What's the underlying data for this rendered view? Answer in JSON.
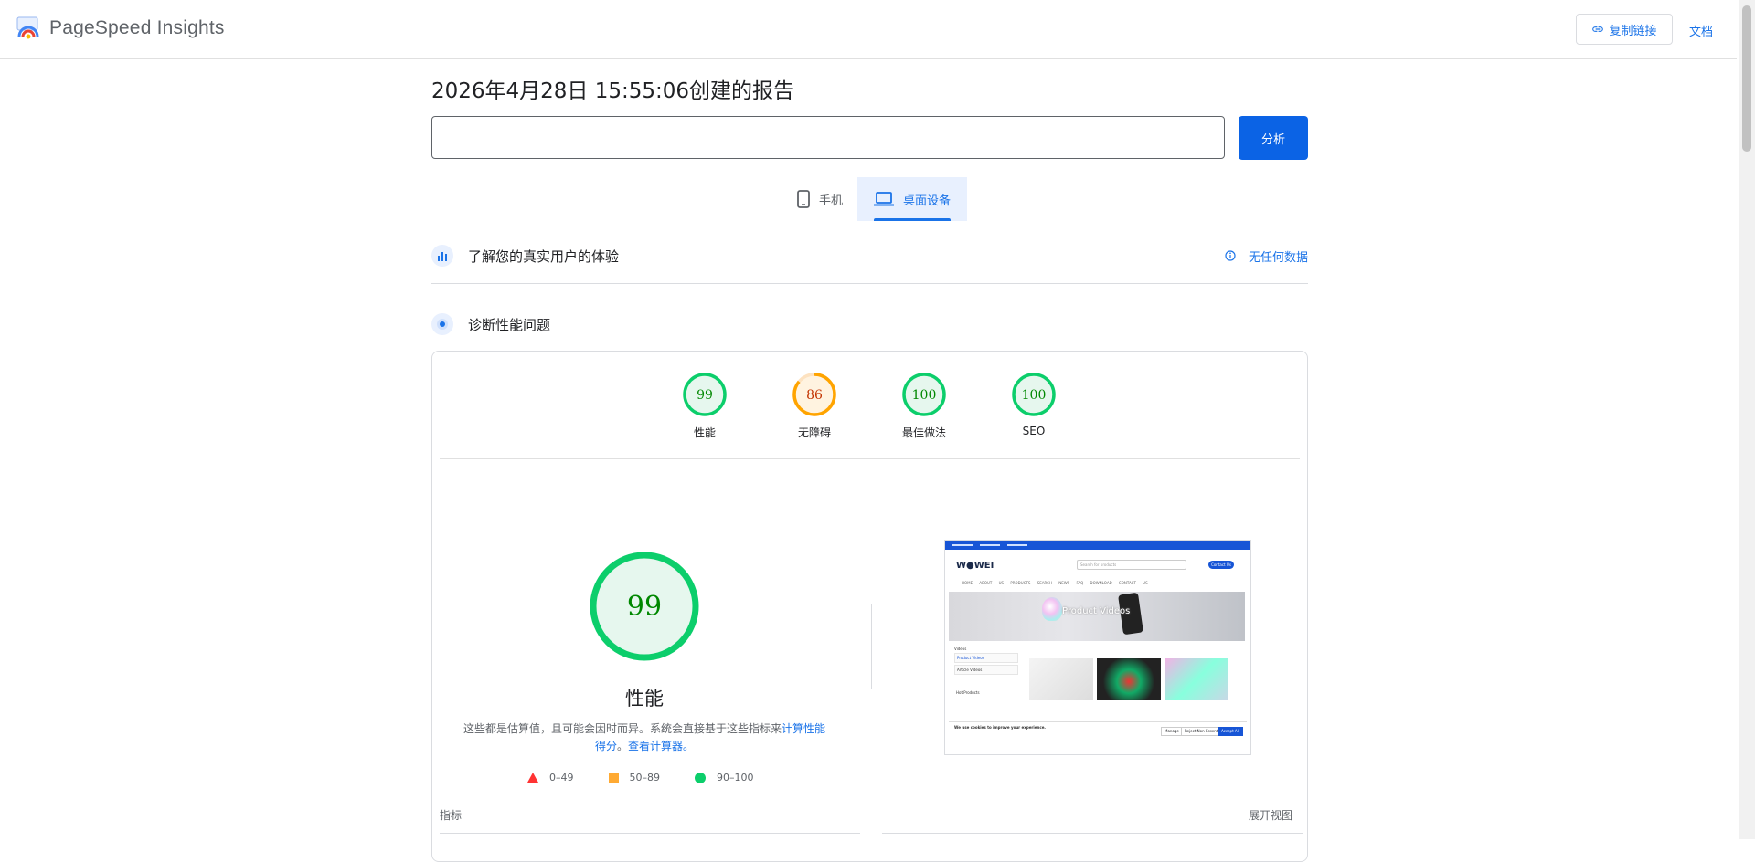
{
  "header": {
    "app_title": "PageSpeed Insights",
    "copy_link_label": "复制链接",
    "docs_label": "文档"
  },
  "report": {
    "title": "2026年4月28日 15:55:06创建的报告",
    "url_value": "",
    "analyze_label": "分析"
  },
  "device_tabs": {
    "mobile_label": "手机",
    "desktop_label": "桌面设备",
    "selected": "desktop"
  },
  "sections": {
    "field_data_label": "了解您的真实用户的体验",
    "no_data_label": "无任何数据",
    "diagnose_label": "诊断性能问题"
  },
  "scores": [
    {
      "label": "性能",
      "value": "99",
      "status": "pass"
    },
    {
      "label": "无障碍",
      "value": "86",
      "status": "average"
    },
    {
      "label": "最佳做法",
      "value": "100",
      "status": "pass"
    },
    {
      "label": "SEO",
      "value": "100",
      "status": "pass"
    }
  ],
  "performance": {
    "score": "99",
    "label": "性能",
    "desc_text": "这些都是估算值，且可能会因时而异。系统会直接基于这些指标来",
    "desc_link1": "计算性能得分",
    "desc_sep": "。",
    "desc_link2": "查看计算器。"
  },
  "legend": [
    {
      "range": "0–49",
      "shape": "triangle",
      "color": "#ff3333"
    },
    {
      "range": "50–89",
      "shape": "square",
      "color": "#ffaa33"
    },
    {
      "range": "90–100",
      "shape": "circle",
      "color": "#0cce6b"
    }
  ],
  "metrics": {
    "label": "指标",
    "expand_label": "展开视图"
  },
  "screenshot": {
    "logo": "W●WEI",
    "search_placeholder": "Search for products",
    "contact_label": "Contact Us",
    "nav": "HOME ABOUT US PRODUCTS SEARCH NEWS FAQ DOWNLOAD CONTACT US",
    "banner_text": "Product Videos",
    "side_title": "Videos",
    "side_item1": "Product Videos",
    "side_item2": "Article Videos",
    "hot_products": "Hot Products",
    "cookie_title": "We use cookies to improve your experience.",
    "manage_label": "Manage",
    "reject_label": "Reject Non-Essential",
    "accept_label": "Accept All"
  },
  "colors": {
    "accent": "#1a73e8",
    "pass": "#0cce6b",
    "average": "#ffa400",
    "pass_bg": "#e6f7ee",
    "average_bg": "#fff3e0"
  }
}
